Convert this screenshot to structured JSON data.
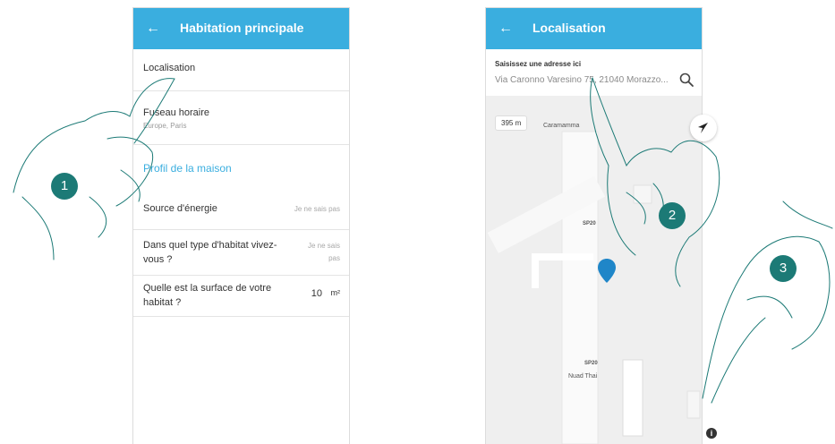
{
  "screen1": {
    "title": "Habitation principale",
    "back_icon": "arrow-left-icon",
    "location_label": "Localisation",
    "timezone_label": "Fuseau horaire",
    "timezone_value": "Europe, Paris",
    "profile_link": "Profil de la maison",
    "energy_label": "Source d'énergie",
    "energy_value": "Je ne sais pas",
    "habitat_label": "Dans quel type d'habitat vivez-vous ?",
    "habitat_value": "Je ne sais pas",
    "surface_label": "Quelle est la surface de votre habitat ?",
    "surface_value": "10",
    "surface_unit": "m²"
  },
  "screen2": {
    "title": "Localisation",
    "back_icon": "arrow-left-icon",
    "search_label": "Saisissez une adresse ici",
    "search_value": "Via Caronno Varesino 75, 21040 Morazzo...",
    "search_icon": "search-icon",
    "map": {
      "scale": "395 m",
      "poi_caramamma": "Caramamma",
      "poi_nuad": "Nuad Thai",
      "road_1": "SP20",
      "road_2": "SP20",
      "navigate_icon": "navigation-arrow-icon",
      "info_icon": "info-icon",
      "marker_icon": "map-pin-icon"
    }
  },
  "steps": [
    "1",
    "2",
    "3"
  ],
  "colors": {
    "appbar": "#3aaedf",
    "badge": "#1c7a76",
    "marker": "#1f86c8"
  }
}
